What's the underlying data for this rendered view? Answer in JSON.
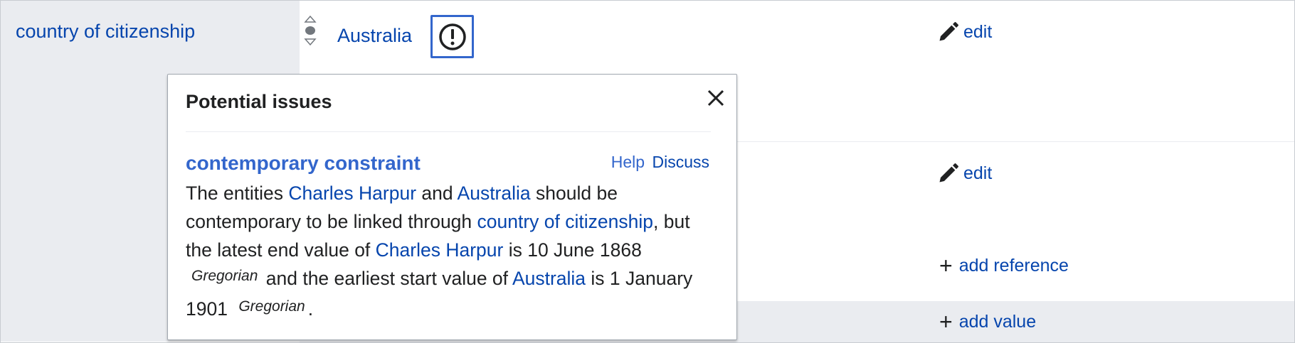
{
  "statement": {
    "property_label": "country of citizenship",
    "value_label": "Australia",
    "issue_button_icon": "exclamation-circle-icon"
  },
  "actions": {
    "edit_label_1": "edit",
    "edit_label_2": "edit",
    "add_reference_label": "add reference",
    "add_value_label": "add value",
    "plus_glyph": "+"
  },
  "popup": {
    "title": "Potential issues",
    "constraint_title": "contemporary constraint",
    "help_label": "Help",
    "discuss_label": "Discuss",
    "text": {
      "t1": "The entities ",
      "link_charles_1": "Charles Harpur",
      "t2": " and ",
      "link_australia_1": "Australia",
      "t3": " should be contemporary to be linked through ",
      "link_property": "country of citizenship",
      "t4": ", but the latest end value of ",
      "link_charles_2": "Charles Harpur",
      "t5": " is 10 June 1868",
      "calendar_1": "Gregorian",
      "t6": " and the earliest start value of ",
      "link_australia_2": "Australia",
      "t7": " is 1 January 1901",
      "calendar_2": "Gregorian",
      "t8": "."
    }
  },
  "colors": {
    "link": "#0645ad",
    "accent": "#3366cc",
    "property_bg": "#eaecf0",
    "text": "#202122"
  }
}
